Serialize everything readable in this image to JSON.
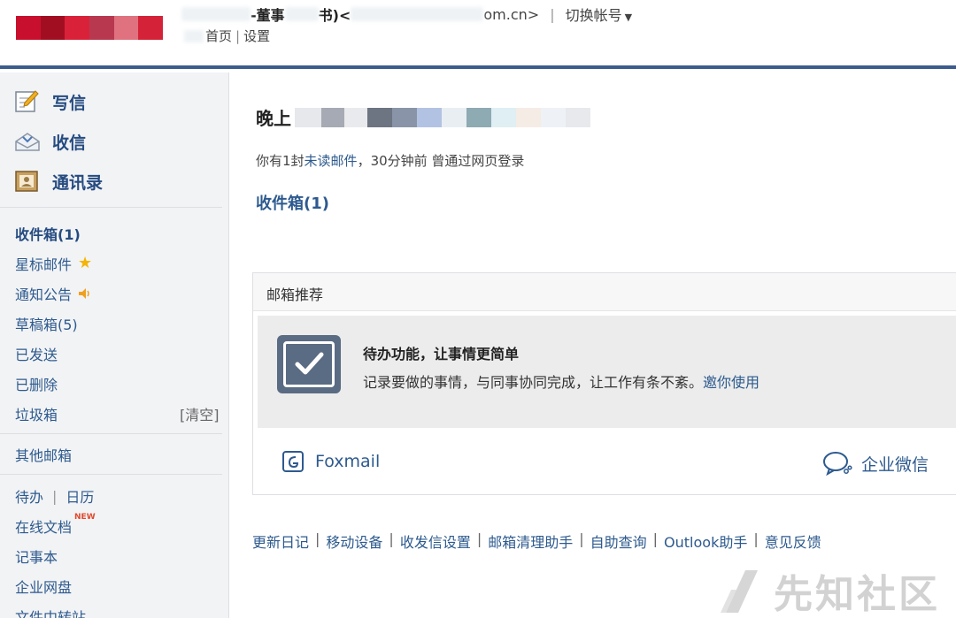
{
  "header": {
    "logo_colors": [
      "#c8102e",
      "#a10e22",
      "#d9223a",
      "#b8384f",
      "#e0727f",
      "#d42338"
    ],
    "account_prefix": "-董事",
    "account_title_end": "书)<",
    "account_email_end": "om.cn>",
    "separator": "|",
    "switch_account": "切换帐号",
    "home_suffix": "首页",
    "link_separator": "|",
    "settings": "设置"
  },
  "sidebar": {
    "compose": "写信",
    "receive": "收信",
    "contacts": "通讯录",
    "folders": [
      {
        "label": "收件箱(1)"
      },
      {
        "label": "星标邮件"
      },
      {
        "label": "通知公告"
      },
      {
        "label": "草稿箱(5)"
      },
      {
        "label": "已发送"
      },
      {
        "label": "已删除"
      },
      {
        "label": "垃圾箱"
      }
    ],
    "clear": "[清空]",
    "other_mailbox": "其他邮箱",
    "todo": "待办",
    "tool_separator": "|",
    "calendar": "日历",
    "online_docs": "在线文档",
    "new_tag": "NEW",
    "notebook": "记事本",
    "netdisk": "企业网盘",
    "file_transfer": "文件中转站"
  },
  "main": {
    "greeting": "晚上",
    "status_prefix": "你有1封",
    "unread_link": "未读邮件",
    "status_suffix": "，30分钟前 曾通过网页登录",
    "inbox_link": "收件箱(1)",
    "recommend": {
      "title": "邮箱推荐",
      "card_title": "待办功能，让事情更简单",
      "card_desc": "记录要做的事情，与同事协同完成，让工作有条不紊。",
      "card_action": "邀你使用",
      "foxmail": "Foxmail",
      "wechat": "企业微信"
    }
  },
  "footer": {
    "links": [
      "更新日记",
      "移动设备",
      "收发信设置",
      "邮箱清理助手",
      "自助查询",
      "Outlook助手",
      "意见反馈"
    ],
    "separator": "|"
  },
  "watermark": "先知社区",
  "colors": {
    "accent": "#2d5a8e",
    "header_bar": "#3c5c8c",
    "sidebar_bg": "#f2f3f5",
    "star": "#f5b400",
    "speaker": "#f0a020"
  }
}
